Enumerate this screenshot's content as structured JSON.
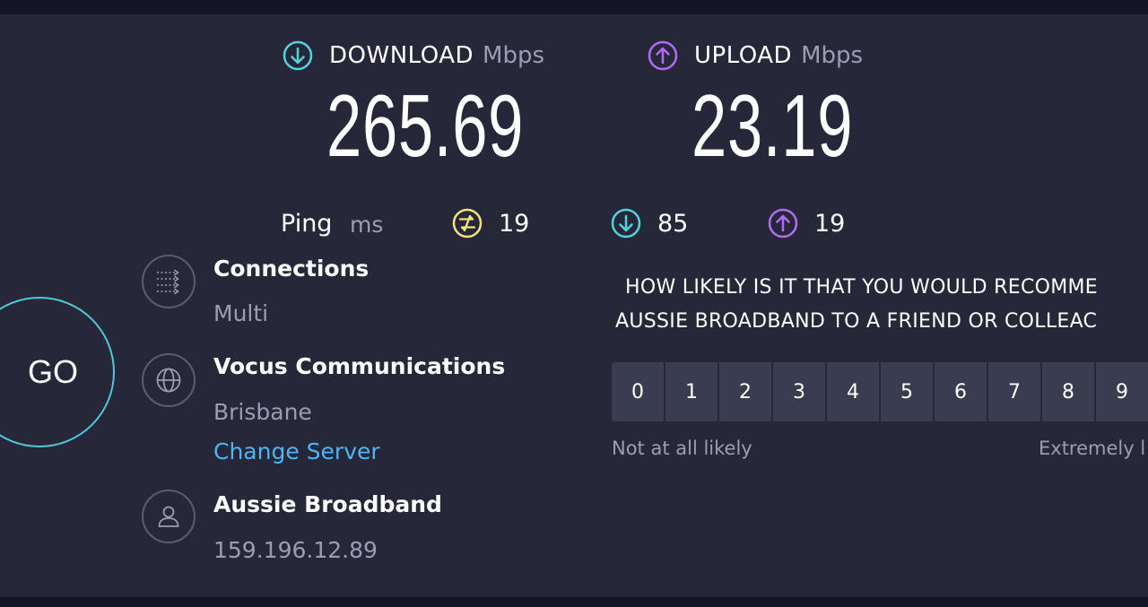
{
  "download": {
    "label": "DOWNLOAD",
    "unit": "Mbps",
    "value": "265.69",
    "icon": "arrow-down-circle-icon",
    "color": "#52d3d9"
  },
  "upload": {
    "label": "UPLOAD",
    "unit": "Mbps",
    "value": "23.19",
    "icon": "arrow-up-circle-icon",
    "color": "#b06cf7"
  },
  "ping": {
    "label": "Ping",
    "unit": "ms",
    "idle": {
      "value": "19",
      "icon": "ping-idle-icon",
      "color": "#f2e27a"
    },
    "download": {
      "value": "85",
      "icon": "arrow-down-circle-icon",
      "color": "#52d3d9"
    },
    "upload": {
      "value": "19",
      "icon": "arrow-up-circle-icon",
      "color": "#b06cf7"
    }
  },
  "go_button": {
    "label": "GO"
  },
  "connections": {
    "title": "Connections",
    "value": "Multi",
    "icon": "connections-icon"
  },
  "server": {
    "name": "Vocus Communications",
    "location": "Brisbane",
    "change_label": "Change Server",
    "icon": "globe-icon"
  },
  "provider": {
    "name": "Aussie Broadband",
    "ip": "159.196.12.89",
    "icon": "user-icon"
  },
  "survey": {
    "question_line1": "HOW LIKELY IS IT THAT YOU WOULD RECOMME",
    "question_line2": "AUSSIE BROADBAND TO A FRIEND OR COLLEAC",
    "scale": [
      "0",
      "1",
      "2",
      "3",
      "4",
      "5",
      "6",
      "7",
      "8",
      "9"
    ],
    "low_label": "Not at all likely",
    "high_label": "Extremely l"
  }
}
